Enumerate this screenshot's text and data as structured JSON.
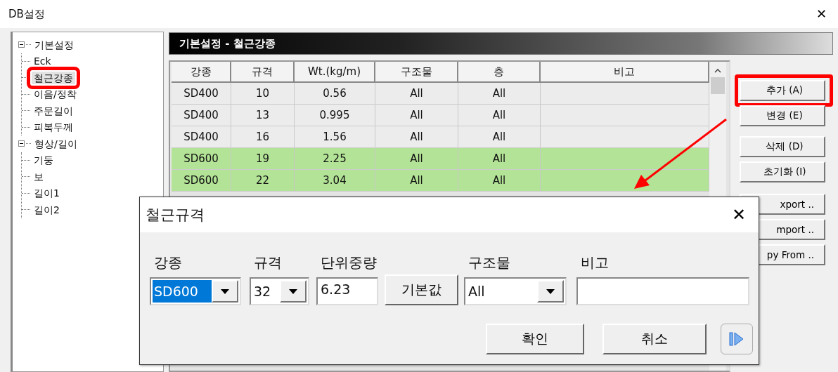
{
  "window": {
    "title": "DB설정",
    "close": "✕"
  },
  "tree": [
    {
      "label": "기본설정",
      "expanded": true,
      "selected": false,
      "children": [
        {
          "label": "Eck",
          "selected": false
        },
        {
          "label": "철근강종",
          "selected": true
        },
        {
          "label": "이음/정착",
          "selected": false
        },
        {
          "label": "주문길이",
          "selected": false
        },
        {
          "label": "피복두께",
          "selected": false
        }
      ]
    },
    {
      "label": "형상/길이",
      "expanded": true,
      "selected": false,
      "children": [
        {
          "label": "기둥",
          "selected": false
        },
        {
          "label": "보",
          "selected": false
        },
        {
          "label": "길이1",
          "selected": false
        },
        {
          "label": "길이2",
          "selected": false
        }
      ]
    }
  ],
  "panel": {
    "title": "기본설정 - 철근강종"
  },
  "table": {
    "columns": [
      "강종",
      "규격",
      "Wt.(kg/m)",
      "구조물",
      "층",
      "비고"
    ],
    "rows": [
      {
        "color": "#ececec",
        "cells": [
          "SD400",
          "10",
          "0.56",
          "All",
          "All",
          ""
        ]
      },
      {
        "color": "#ececec",
        "cells": [
          "SD400",
          "13",
          "0.995",
          "All",
          "All",
          ""
        ]
      },
      {
        "color": "#ececec",
        "cells": [
          "SD400",
          "16",
          "1.56",
          "All",
          "All",
          ""
        ]
      },
      {
        "color": "#b3e396",
        "cells": [
          "SD600",
          "19",
          "2.25",
          "All",
          "All",
          ""
        ]
      },
      {
        "color": "#b3e396",
        "cells": [
          "SD600",
          "22",
          "3.04",
          "All",
          "All",
          ""
        ]
      }
    ]
  },
  "buttons": [
    {
      "label": "추가 (A)",
      "highlighted": true
    },
    {
      "label": "변경 (E)",
      "highlighted": false
    },
    {
      "label": "삭제 (D)",
      "highlighted": false
    },
    {
      "label": "초기화 (I)",
      "highlighted": false
    },
    {
      "label": "xport ..",
      "highlighted": false
    },
    {
      "label": "mport ..",
      "highlighted": false
    },
    {
      "label": "py From ..",
      "highlighted": false
    }
  ],
  "dialog": {
    "title": "철근규격",
    "close": "✕",
    "fields": [
      {
        "kind": "combo",
        "label": "강종",
        "value": "SD600",
        "focused": true
      },
      {
        "kind": "combo",
        "label": "규격",
        "value": "32",
        "focused": false
      },
      {
        "kind": "input",
        "label": "단위중량",
        "value": "6.23",
        "focused": false
      },
      {
        "kind": "button",
        "value": "기본값",
        "focused": false
      },
      {
        "kind": "combo",
        "label": "구조물",
        "value": "All",
        "focused": false
      },
      {
        "kind": "input",
        "label": "비고",
        "focused": false
      }
    ],
    "ok": "확인",
    "cancel": "취소"
  }
}
